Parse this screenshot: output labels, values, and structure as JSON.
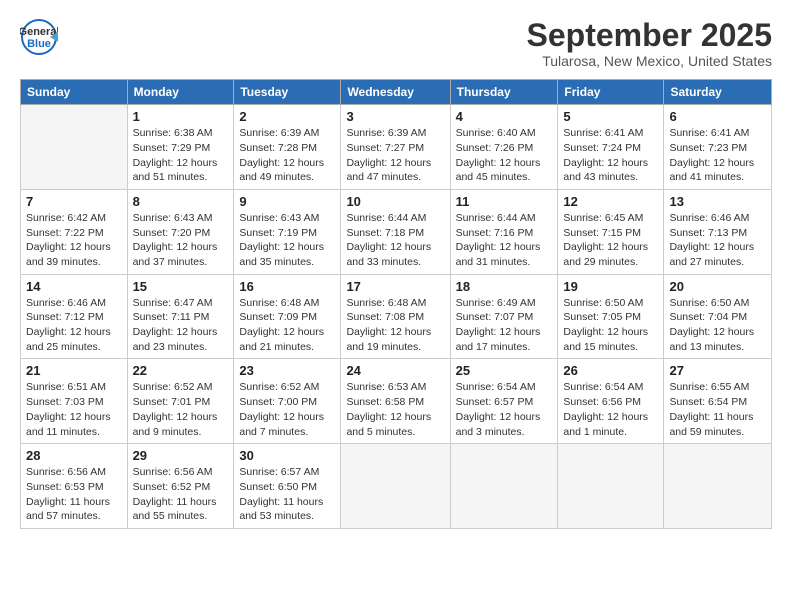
{
  "header": {
    "logo_line1": "General",
    "logo_line2": "Blue",
    "title": "September 2025",
    "subtitle": "Tularosa, New Mexico, United States"
  },
  "weekdays": [
    "Sunday",
    "Monday",
    "Tuesday",
    "Wednesday",
    "Thursday",
    "Friday",
    "Saturday"
  ],
  "weeks": [
    [
      {
        "day": "",
        "info": ""
      },
      {
        "day": "1",
        "info": "Sunrise: 6:38 AM\nSunset: 7:29 PM\nDaylight: 12 hours\nand 51 minutes."
      },
      {
        "day": "2",
        "info": "Sunrise: 6:39 AM\nSunset: 7:28 PM\nDaylight: 12 hours\nand 49 minutes."
      },
      {
        "day": "3",
        "info": "Sunrise: 6:39 AM\nSunset: 7:27 PM\nDaylight: 12 hours\nand 47 minutes."
      },
      {
        "day": "4",
        "info": "Sunrise: 6:40 AM\nSunset: 7:26 PM\nDaylight: 12 hours\nand 45 minutes."
      },
      {
        "day": "5",
        "info": "Sunrise: 6:41 AM\nSunset: 7:24 PM\nDaylight: 12 hours\nand 43 minutes."
      },
      {
        "day": "6",
        "info": "Sunrise: 6:41 AM\nSunset: 7:23 PM\nDaylight: 12 hours\nand 41 minutes."
      }
    ],
    [
      {
        "day": "7",
        "info": "Sunrise: 6:42 AM\nSunset: 7:22 PM\nDaylight: 12 hours\nand 39 minutes."
      },
      {
        "day": "8",
        "info": "Sunrise: 6:43 AM\nSunset: 7:20 PM\nDaylight: 12 hours\nand 37 minutes."
      },
      {
        "day": "9",
        "info": "Sunrise: 6:43 AM\nSunset: 7:19 PM\nDaylight: 12 hours\nand 35 minutes."
      },
      {
        "day": "10",
        "info": "Sunrise: 6:44 AM\nSunset: 7:18 PM\nDaylight: 12 hours\nand 33 minutes."
      },
      {
        "day": "11",
        "info": "Sunrise: 6:44 AM\nSunset: 7:16 PM\nDaylight: 12 hours\nand 31 minutes."
      },
      {
        "day": "12",
        "info": "Sunrise: 6:45 AM\nSunset: 7:15 PM\nDaylight: 12 hours\nand 29 minutes."
      },
      {
        "day": "13",
        "info": "Sunrise: 6:46 AM\nSunset: 7:13 PM\nDaylight: 12 hours\nand 27 minutes."
      }
    ],
    [
      {
        "day": "14",
        "info": "Sunrise: 6:46 AM\nSunset: 7:12 PM\nDaylight: 12 hours\nand 25 minutes."
      },
      {
        "day": "15",
        "info": "Sunrise: 6:47 AM\nSunset: 7:11 PM\nDaylight: 12 hours\nand 23 minutes."
      },
      {
        "day": "16",
        "info": "Sunrise: 6:48 AM\nSunset: 7:09 PM\nDaylight: 12 hours\nand 21 minutes."
      },
      {
        "day": "17",
        "info": "Sunrise: 6:48 AM\nSunset: 7:08 PM\nDaylight: 12 hours\nand 19 minutes."
      },
      {
        "day": "18",
        "info": "Sunrise: 6:49 AM\nSunset: 7:07 PM\nDaylight: 12 hours\nand 17 minutes."
      },
      {
        "day": "19",
        "info": "Sunrise: 6:50 AM\nSunset: 7:05 PM\nDaylight: 12 hours\nand 15 minutes."
      },
      {
        "day": "20",
        "info": "Sunrise: 6:50 AM\nSunset: 7:04 PM\nDaylight: 12 hours\nand 13 minutes."
      }
    ],
    [
      {
        "day": "21",
        "info": "Sunrise: 6:51 AM\nSunset: 7:03 PM\nDaylight: 12 hours\nand 11 minutes."
      },
      {
        "day": "22",
        "info": "Sunrise: 6:52 AM\nSunset: 7:01 PM\nDaylight: 12 hours\nand 9 minutes."
      },
      {
        "day": "23",
        "info": "Sunrise: 6:52 AM\nSunset: 7:00 PM\nDaylight: 12 hours\nand 7 minutes."
      },
      {
        "day": "24",
        "info": "Sunrise: 6:53 AM\nSunset: 6:58 PM\nDaylight: 12 hours\nand 5 minutes."
      },
      {
        "day": "25",
        "info": "Sunrise: 6:54 AM\nSunset: 6:57 PM\nDaylight: 12 hours\nand 3 minutes."
      },
      {
        "day": "26",
        "info": "Sunrise: 6:54 AM\nSunset: 6:56 PM\nDaylight: 12 hours\nand 1 minute."
      },
      {
        "day": "27",
        "info": "Sunrise: 6:55 AM\nSunset: 6:54 PM\nDaylight: 11 hours\nand 59 minutes."
      }
    ],
    [
      {
        "day": "28",
        "info": "Sunrise: 6:56 AM\nSunset: 6:53 PM\nDaylight: 11 hours\nand 57 minutes."
      },
      {
        "day": "29",
        "info": "Sunrise: 6:56 AM\nSunset: 6:52 PM\nDaylight: 11 hours\nand 55 minutes."
      },
      {
        "day": "30",
        "info": "Sunrise: 6:57 AM\nSunset: 6:50 PM\nDaylight: 11 hours\nand 53 minutes."
      },
      {
        "day": "",
        "info": ""
      },
      {
        "day": "",
        "info": ""
      },
      {
        "day": "",
        "info": ""
      },
      {
        "day": "",
        "info": ""
      }
    ]
  ]
}
